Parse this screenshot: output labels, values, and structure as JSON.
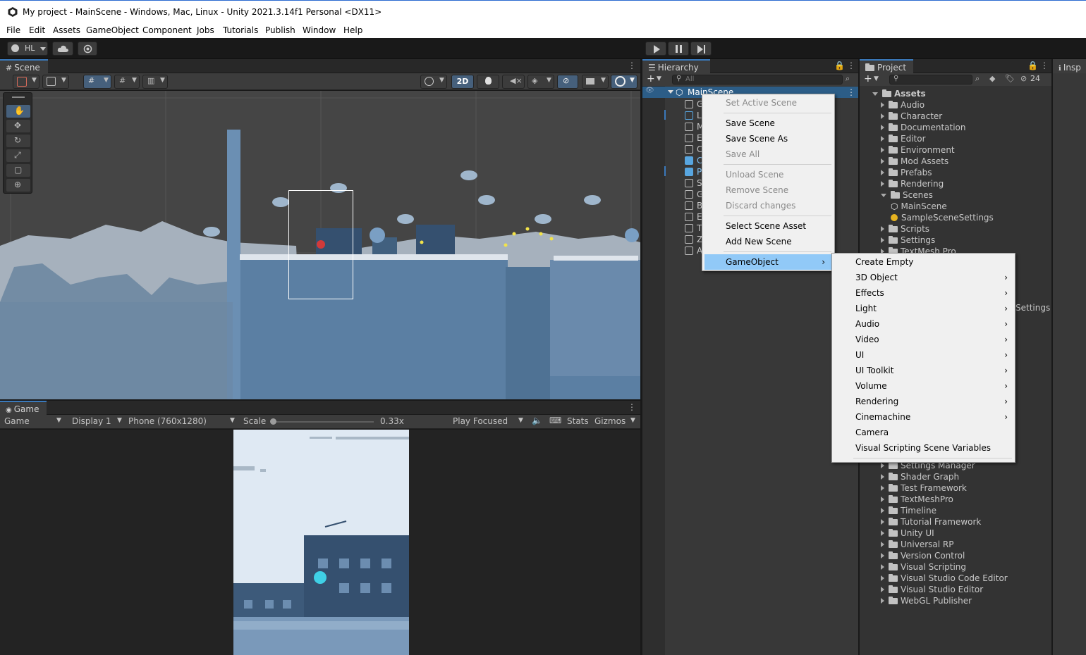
{
  "window": {
    "title": "My project - MainScene - Windows, Mac, Linux - Unity 2021.3.14f1 Personal <DX11>"
  },
  "menubar": [
    "File",
    "Edit",
    "Assets",
    "GameObject",
    "Component",
    "Jobs",
    "Tutorials",
    "Publish",
    "Window",
    "Help"
  ],
  "toolbar": {
    "account_label": "HL"
  },
  "scene_panel": {
    "tab_label": "Scene",
    "mode_2d_label": "2D"
  },
  "game_panel": {
    "tab_label": "Game",
    "view_dropdown": "Game",
    "display_dropdown": "Display 1",
    "resolution_dropdown": "Phone (760x1280)",
    "scale_label": "Scale",
    "scale_value": "0.33x",
    "play_mode_dropdown": "Play Focused",
    "stats_label": "Stats",
    "gizmos_label": "Gizmos"
  },
  "hierarchy": {
    "tab_label": "Hierarchy",
    "search_placeholder": "All",
    "scene_name": "MainScene",
    "child_initials": [
      "G",
      "L",
      "M",
      "E",
      "C",
      "C",
      "P",
      "S",
      "G",
      "B",
      "E",
      "T",
      "Z",
      "A"
    ]
  },
  "project": {
    "tab_label": "Project",
    "hidden_count": "24",
    "root": "Assets",
    "folders": [
      "Audio",
      "Character",
      "Documentation",
      "Editor",
      "Environment",
      "Mod Assets",
      "Prefabs",
      "Rendering",
      "Scenes"
    ],
    "scene_items": [
      "MainScene",
      "SampleSceneSettings"
    ],
    "folders_after": [
      "Scripts",
      "Settings",
      "TextMesh Pro"
    ],
    "folders_lower": [
      "Settings Manager",
      "Shader Graph",
      "Test Framework",
      "TextMeshPro",
      "Timeline",
      "Tutorial Framework",
      "Unity UI",
      "Universal RP",
      "Version Control",
      "Visual Scripting",
      "Visual Studio Code Editor",
      "Visual Studio Editor",
      "WebGL Publisher"
    ],
    "partial_settings_text": "Settings"
  },
  "inspector": {
    "tab_label": "Insp"
  },
  "context_menu": {
    "items": [
      {
        "label": "Set Active Scene",
        "enabled": false
      },
      {
        "label": "Save Scene",
        "enabled": true
      },
      {
        "label": "Save Scene As",
        "enabled": true
      },
      {
        "label": "Save All",
        "enabled": false
      },
      {
        "label": "Unload Scene",
        "enabled": false
      },
      {
        "label": "Remove Scene",
        "enabled": false
      },
      {
        "label": "Discard changes",
        "enabled": false
      },
      {
        "label": "Select Scene Asset",
        "enabled": true
      },
      {
        "label": "Add New Scene",
        "enabled": true
      },
      {
        "label": "GameObject",
        "enabled": true,
        "submenu": true,
        "highlighted": true
      }
    ]
  },
  "gameobject_submenu": {
    "items": [
      {
        "label": "Create Empty",
        "submenu": false
      },
      {
        "label": "3D Object",
        "submenu": true
      },
      {
        "label": "Effects",
        "submenu": true
      },
      {
        "label": "Light",
        "submenu": true
      },
      {
        "label": "Audio",
        "submenu": true
      },
      {
        "label": "Video",
        "submenu": true
      },
      {
        "label": "UI",
        "submenu": true
      },
      {
        "label": "UI Toolkit",
        "submenu": true
      },
      {
        "label": "Volume",
        "submenu": true
      },
      {
        "label": "Rendering",
        "submenu": true
      },
      {
        "label": "Cinemachine",
        "submenu": true
      },
      {
        "label": "Camera",
        "submenu": false
      },
      {
        "label": "Visual Scripting Scene Variables",
        "submenu": false
      }
    ]
  },
  "colors": {
    "selection_blue": "#2c5d87",
    "menu_highlight": "#91c9f7",
    "scene_sky": "#3a3a3a",
    "scene_ground": "#5b7fa3",
    "game_sky": "#dfe9f3"
  }
}
